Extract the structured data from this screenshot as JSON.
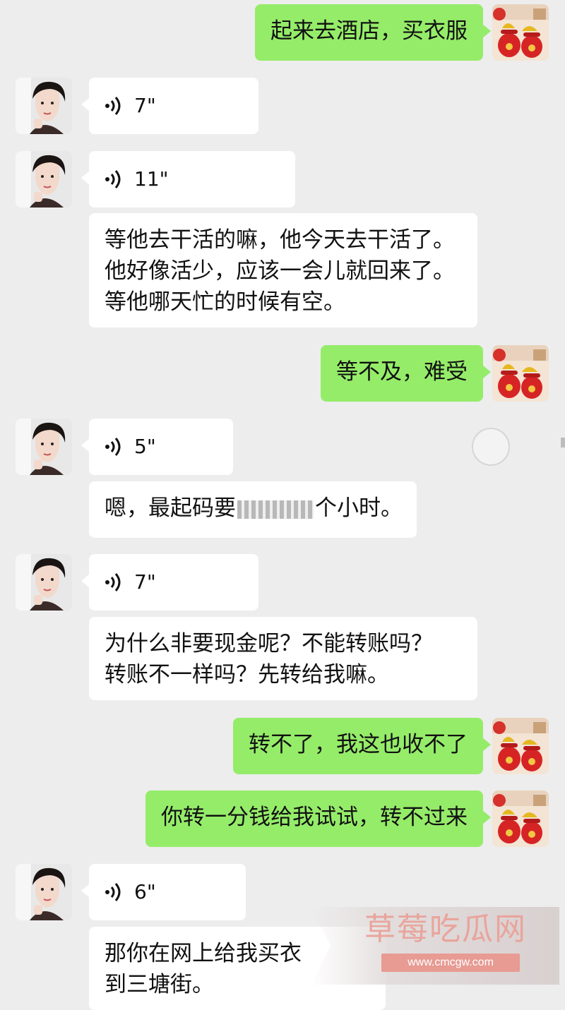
{
  "messages": [
    {
      "id": "m1",
      "side": "out",
      "text": "起来去酒店，买衣服"
    },
    {
      "id": "m2",
      "side": "in",
      "type": "voice",
      "duration": "7\""
    },
    {
      "id": "m3",
      "side": "in",
      "type": "voice",
      "duration": "11\""
    },
    {
      "id": "m4",
      "side": "in",
      "type": "text",
      "lines": [
        "等他去干活的嘛，他今天去干活了。",
        "他好像活少，应该一会儿就回来了。",
        "等他哪天忙的时候有空。"
      ]
    },
    {
      "id": "m5",
      "side": "out",
      "text": "等不及，难受"
    },
    {
      "id": "m6",
      "side": "in",
      "type": "voice",
      "duration": "5\""
    },
    {
      "id": "m7",
      "side": "in",
      "type": "text",
      "lines": [
        "嗯，最起码要",
        "个小时。"
      ]
    },
    {
      "id": "m8",
      "side": "in",
      "type": "voice",
      "duration": "7\""
    },
    {
      "id": "m9",
      "side": "in",
      "type": "text",
      "lines": [
        "为什么非要现金呢？不能转账吗？",
        "转账不一样吗？先转给我嘛。"
      ]
    },
    {
      "id": "m10",
      "side": "out",
      "text": "转不了，我这也收不了"
    },
    {
      "id": "m11",
      "side": "out",
      "text": "你转一分钱给我试试，转不过来"
    },
    {
      "id": "m12",
      "side": "in",
      "type": "voice",
      "duration": "6\""
    },
    {
      "id": "m13",
      "side": "in",
      "type": "text",
      "lines": [
        "那你在网上给我买衣",
        "到三塘街。"
      ]
    }
  ],
  "watermark": {
    "title": "草莓吃瓜网",
    "url": "www.cmcgw.com"
  },
  "colors": {
    "outgoing": "#95ec69",
    "incoming": "#ffffff",
    "background": "#ededed"
  },
  "icons": {
    "voice": "voice-wave-icon",
    "my_avatar": "lucky-bag-avatar",
    "contact_avatar": "woman-portrait-avatar"
  }
}
